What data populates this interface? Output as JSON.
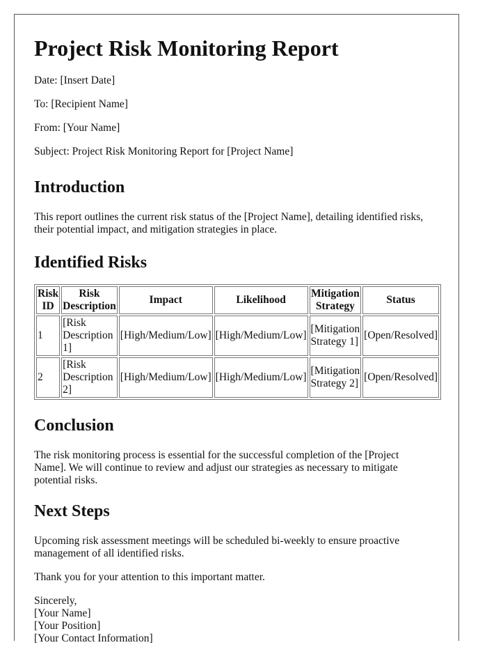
{
  "title": "Project Risk Monitoring Report",
  "meta": {
    "date": "Date: [Insert Date]",
    "to": "To: [Recipient Name]",
    "from": "From: [Your Name]",
    "subject": "Subject: Project Risk Monitoring Report for [Project Name]"
  },
  "introduction": {
    "heading": "Introduction",
    "text": "This report outlines the current risk status of the [Project Name], detailing identified risks, their potential impact, and mitigation strategies in place."
  },
  "risks": {
    "heading": "Identified Risks",
    "columns": [
      "Risk ID",
      "Risk Description",
      "Impact",
      "Likelihood",
      "Mitigation Strategy",
      "Status"
    ],
    "rows": [
      [
        "1",
        "[Risk Description 1]",
        "[High/Medium/Low]",
        "[High/Medium/Low]",
        "[Mitigation Strategy 1]",
        "[Open/Resolved]"
      ],
      [
        "2",
        "[Risk Description 2]",
        "[High/Medium/Low]",
        "[High/Medium/Low]",
        "[Mitigation Strategy 2]",
        "[Open/Resolved]"
      ]
    ]
  },
  "conclusion": {
    "heading": "Conclusion",
    "text": "The risk monitoring process is essential for the successful completion of the [Project Name]. We will continue to review and adjust our strategies as necessary to mitigate potential risks."
  },
  "next_steps": {
    "heading": "Next Steps",
    "text": "Upcoming risk assessment meetings will be scheduled bi-weekly to ensure proactive management of all identified risks.",
    "thanks": "Thank you for your attention to this important matter."
  },
  "signoff": {
    "closing": "Sincerely,",
    "name": "[Your Name]",
    "position": "[Your Position]",
    "contact": "[Your Contact Information]"
  }
}
